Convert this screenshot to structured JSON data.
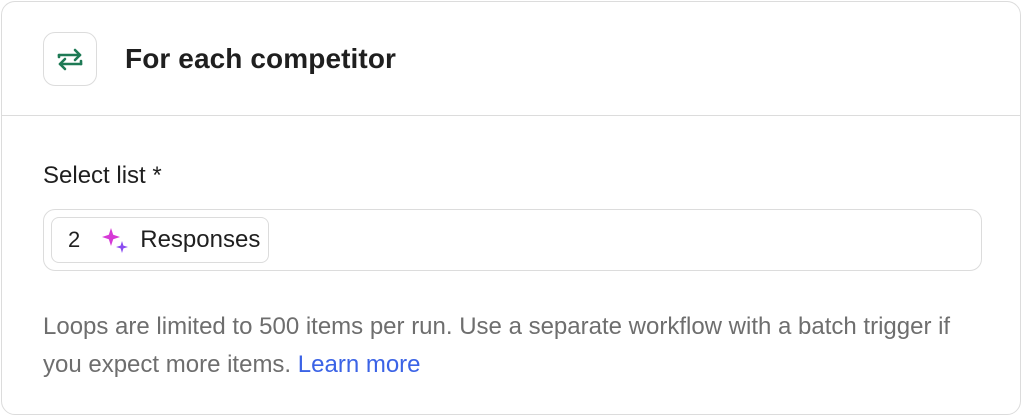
{
  "header": {
    "icon": "loop-arrows-icon",
    "icon_color": "#1e7a55",
    "title": "For each competitor"
  },
  "field": {
    "label": "Select list *",
    "token": {
      "step_number": "2",
      "icon": "ai-sparkle-icon",
      "icon_colors": [
        "#d63ad6",
        "#8a4cf0"
      ],
      "label": "Responses"
    }
  },
  "helper": {
    "text": "Loops are limited to 500 items per run. Use a separate workflow with a batch trigger if you expect more items.",
    "link_text": "Learn more",
    "link_color": "#3b63e6"
  }
}
